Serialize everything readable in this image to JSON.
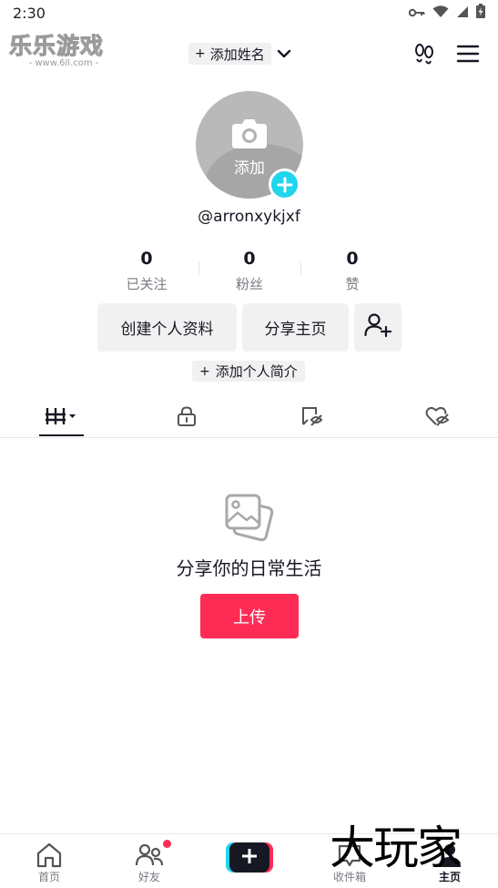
{
  "status_bar": {
    "time": "2:30",
    "icons": [
      "key-icon",
      "wifi-icon",
      "cell-signal-icon",
      "battery-charging-icon"
    ]
  },
  "watermark_top": {
    "title": "乐乐游戏",
    "url": "- www.6ll.com -"
  },
  "header": {
    "add_name_plus": "+",
    "add_name_label": "添加姓名",
    "icons": [
      "chevron-down-icon",
      "footprints-icon",
      "menu-icon"
    ]
  },
  "profile": {
    "avatar_label": "添加",
    "username": "@arronxykjxf"
  },
  "stats": [
    {
      "value": "0",
      "label": "已关注"
    },
    {
      "value": "0",
      "label": "粉丝"
    },
    {
      "value": "0",
      "label": "赞"
    }
  ],
  "actions": {
    "edit_profile": "创建个人资料",
    "share_profile": "分享主页",
    "bio_plus": "+",
    "bio": "添加个人简介"
  },
  "tabs": [
    "videos-grid-icon",
    "private-lock-icon",
    "favorites-icon",
    "liked-icon"
  ],
  "empty_state": {
    "title": "分享你的日常生活",
    "upload": "上传"
  },
  "bottom_nav": {
    "home": "首页",
    "friends": "好友",
    "inbox": "收件箱",
    "profile": "主页"
  },
  "watermark_bottom": "大玩家",
  "colors": {
    "accent": "#fe2c55",
    "cyan": "#20d5ec",
    "text": "#161823",
    "muted": "#7a7b82",
    "chip_bg": "#f1f1f2"
  }
}
